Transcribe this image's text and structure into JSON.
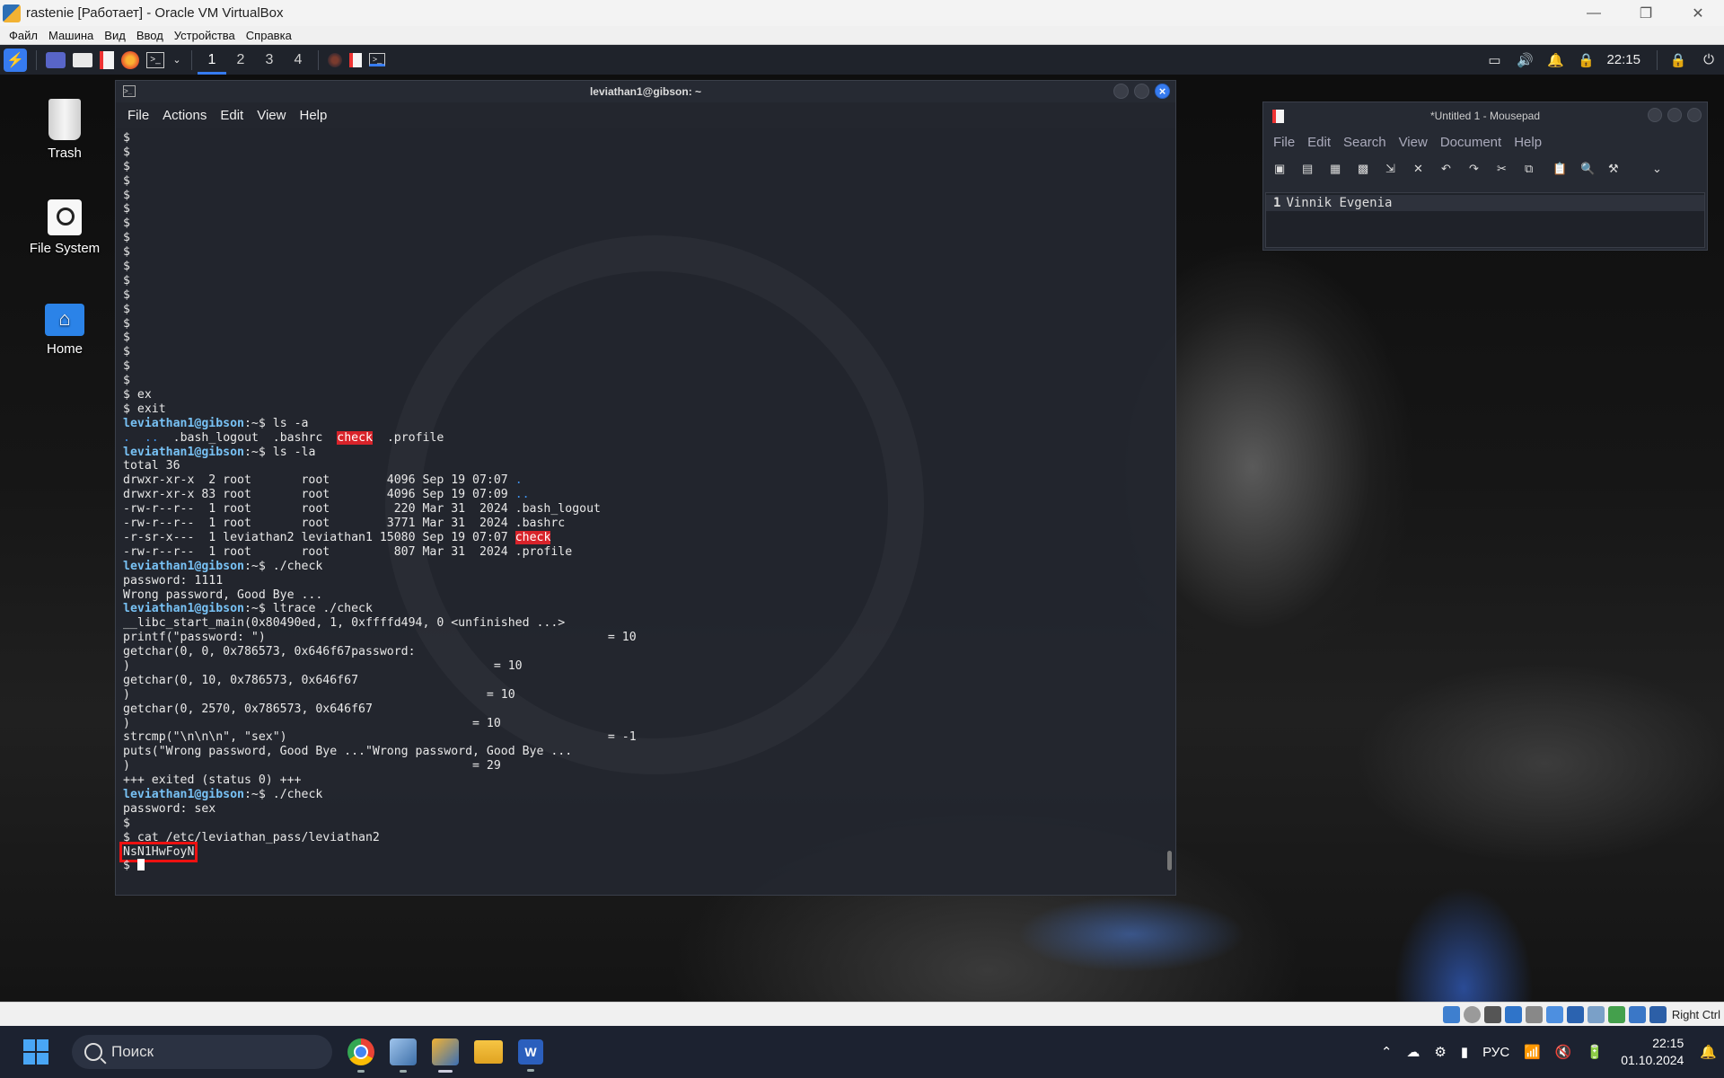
{
  "host_window": {
    "title": "rastenie [Работает] - Oracle VM VirtualBox",
    "menu": [
      "Файл",
      "Машина",
      "Вид",
      "Ввод",
      "Устройства",
      "Справка"
    ],
    "controls": [
      "—",
      "❐",
      "✕"
    ]
  },
  "kali_panel": {
    "workspaces": [
      "1",
      "2",
      "3",
      "4"
    ],
    "active_workspace": "1",
    "clock": "22:15"
  },
  "desktop_icons": [
    {
      "label": "Trash",
      "icon": "trash-icon"
    },
    {
      "label": "File System",
      "icon": "drive-icon"
    },
    {
      "label": "Home",
      "icon": "home-folder-icon"
    }
  ],
  "terminal": {
    "title": "leviathan1@gibson: ~",
    "menu": [
      "File",
      "Actions",
      "Edit",
      "View",
      "Help"
    ],
    "prompt_user": "leviathan1@gibson",
    "prompt_sep": ":~$ ",
    "dollar_lines": [
      "$",
      "$",
      "$",
      "$",
      "$",
      "$",
      "$",
      "$",
      "$",
      "$",
      "$",
      "$",
      "$",
      "$",
      "$",
      "$",
      "$",
      "$"
    ],
    "l_ex": "$ ex",
    "l_exit": "$ exit",
    "c_lsa": "ls -a",
    "lsa_dot": ".",
    "lsa_dotdot": "..",
    "lsa_mid": ".bash_logout  .bashrc  ",
    "lsa_check": "check",
    "lsa_end": "  .profile",
    "c_lsla": "ls -la",
    "total": "total 36",
    "la1": "drwxr-xr-x  2 root       root        4096 Sep 19 07:07 ",
    "la1n": ".",
    "la2": "drwxr-xr-x 83 root       root        4096 Sep 19 07:09 ",
    "la2n": "..",
    "la3": "-rw-r--r--  1 root       root         220 Mar 31  2024 .bash_logout",
    "la4": "-rw-r--r--  1 root       root        3771 Mar 31  2024 .bashrc",
    "la5": "-r-sr-x---  1 leviathan2 leviathan1 15080 Sep 19 07:07 ",
    "la5n": "check",
    "la6": "-rw-r--r--  1 root       root         807 Mar 31  2024 .profile",
    "c_check1": "./check",
    "pw1": "password: 1111",
    "wrong": "Wrong password, Good Bye ...",
    "c_ltrace": "ltrace ./check",
    "lt1": "__libc_start_main(0x80490ed, 1, 0xffffd494, 0 <unfinished ...>",
    "lt2": "printf(\"password: \")                                                = 10",
    "lt3": "getchar(0, 0, 0x786573, 0x646f67password:",
    "lt4": ")                                                   = 10",
    "lt5": "getchar(0, 10, 0x786573, 0x646f67",
    "lt6": ")                                                  = 10",
    "lt7": "getchar(0, 2570, 0x786573, 0x646f67",
    "lt8": ")                                                = 10",
    "lt9": "strcmp(\"\\n\\n\\n\", \"sex\")                                             = -1",
    "lt10": "puts(\"Wrong password, Good Bye ...\"Wrong password, Good Bye ...",
    "lt11": ")                                                = 29",
    "lt12": "+++ exited (status 0) +++",
    "c_check2": "./check",
    "pw2": "password: sex",
    "l_dollar": "$",
    "l_cat": "$ cat /etc/leviathan_pass/leviathan2",
    "password_out": "NsN1HwFoyN",
    "l_last": "$ "
  },
  "mousepad": {
    "title": "*Untitled 1 - Mousepad",
    "menu": [
      "File",
      "Edit",
      "Search",
      "View",
      "Document",
      "Help"
    ],
    "line_number": "1",
    "content": "Vinnik Evgenia"
  },
  "vb_status": {
    "host_key": "Right Ctrl"
  },
  "windows_taskbar": {
    "search_placeholder": "Поиск",
    "language": "РУС",
    "time": "22:15",
    "date": "01.10.2024"
  },
  "colors": {
    "prompt": "#78c2f5",
    "highlight": "#d8232a",
    "kali_blue": "#367bf0",
    "annotation_box": "#e11111"
  }
}
